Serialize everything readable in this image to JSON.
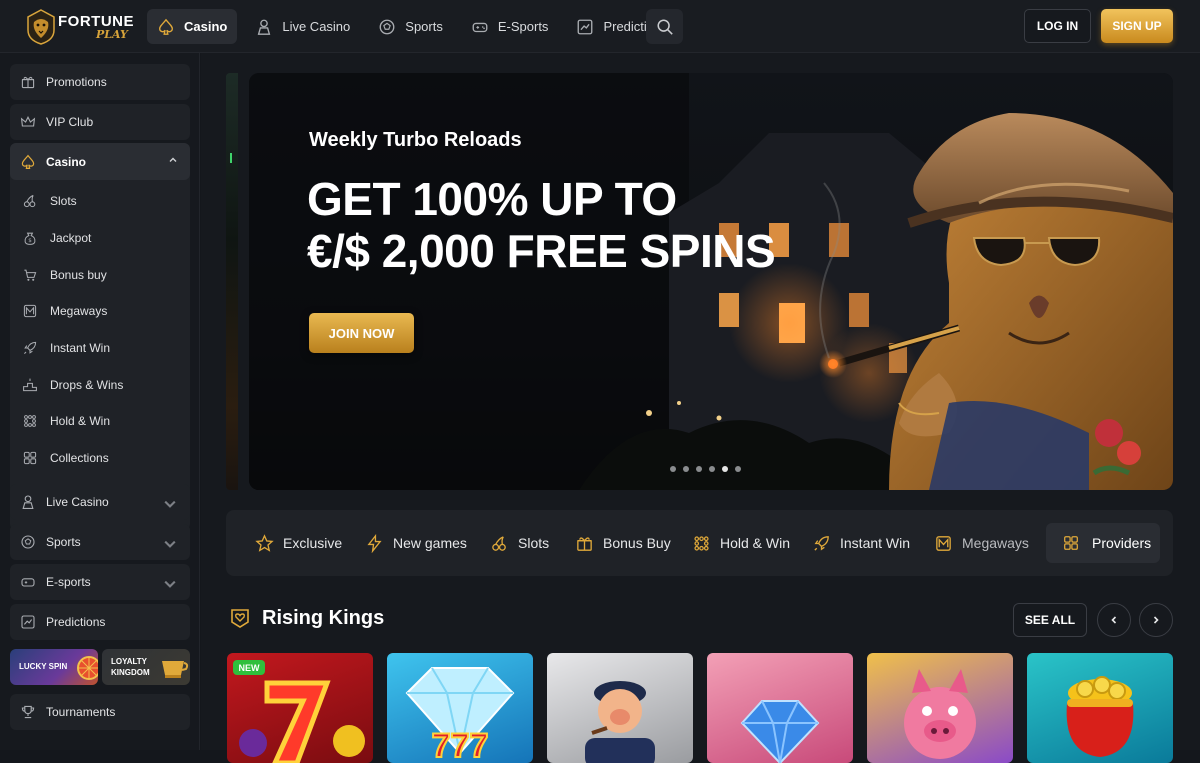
{
  "header": {
    "logo_text": "FORTUNE",
    "logo_sub": "PLAY",
    "nav": [
      {
        "label": "Casino",
        "icon": "spade-icon",
        "active": true
      },
      {
        "label": "Live Casino",
        "icon": "dealer-icon"
      },
      {
        "label": "Sports",
        "icon": "football-icon"
      },
      {
        "label": "E-Sports",
        "icon": "gamepad-icon"
      },
      {
        "label": "Predictions",
        "icon": "chart-icon"
      }
    ],
    "login_label": "LOG IN",
    "signup_label": "SIGN UP"
  },
  "sidebar": {
    "promotions": "Promotions",
    "vip_club": "VIP Club",
    "casino": {
      "label": "Casino",
      "items": [
        {
          "label": "Slots",
          "icon": "cherries-icon"
        },
        {
          "label": "Jackpot",
          "icon": "jackpot-bag-icon"
        },
        {
          "label": "Bonus buy",
          "icon": "bonus-buy-icon"
        },
        {
          "label": "Megaways",
          "icon": "megaways-icon"
        },
        {
          "label": "Instant Win",
          "icon": "rocket-icon"
        },
        {
          "label": "Drops & Wins",
          "icon": "podium-icon"
        },
        {
          "label": "Hold & Win",
          "icon": "dots-grid-icon"
        },
        {
          "label": "Collections",
          "icon": "collections-icon"
        }
      ]
    },
    "live_casino": "Live Casino",
    "sports": "Sports",
    "esports": "E-sports",
    "predictions": "Predictions",
    "lucky_spin": "LUCKY SPIN",
    "loyalty_kingdom": "LOYALTY KINGDOM",
    "tournaments": "Tournaments"
  },
  "banner": {
    "subtitle": "Weekly Turbo Reloads",
    "headline_line1": "GET 100% UP TO",
    "headline_line2": "€/$ 2,000 FREE SPINS",
    "cta_label": "JOIN NOW",
    "slide_count": 6,
    "active_slide": 4
  },
  "categories": [
    {
      "label": "Exclusive",
      "icon": "star-icon"
    },
    {
      "label": "New games",
      "icon": "lightning-icon"
    },
    {
      "label": "Slots",
      "icon": "cherries-icon"
    },
    {
      "label": "Bonus Buy",
      "icon": "gift-icon"
    },
    {
      "label": "Hold & Win",
      "icon": "dots-grid-icon"
    },
    {
      "label": "Instant Win",
      "icon": "rocket-icon"
    },
    {
      "label": "Megaways",
      "icon": "megaways-icon"
    },
    {
      "label": "Providers",
      "icon": "grid-icon"
    }
  ],
  "section": {
    "title": "Rising Kings",
    "see_all": "SEE ALL",
    "new_badge": "NEW"
  },
  "colors": {
    "accent_gold": "#e9b951",
    "background": "#16191e",
    "panel": "#1f2227",
    "new_badge": "#2fbf3c"
  }
}
